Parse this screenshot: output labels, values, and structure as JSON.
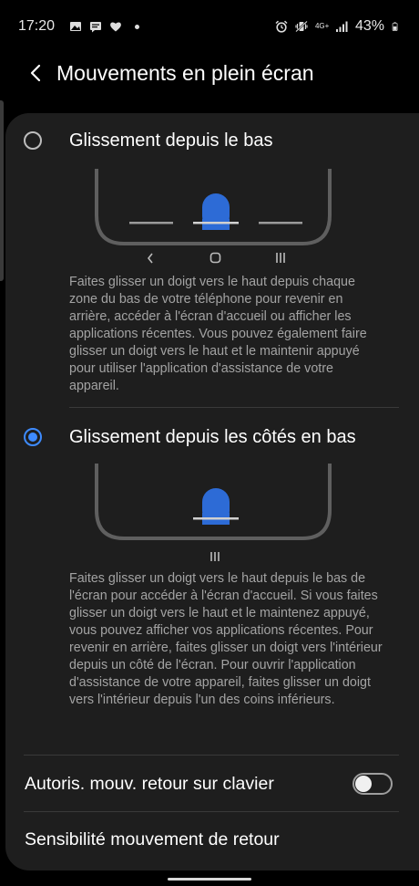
{
  "status_bar": {
    "time": "17:20",
    "battery_text": "43%",
    "network_label": "4G+",
    "left_icons": [
      "image-icon",
      "message-icon",
      "heart-icon",
      "dot-icon"
    ],
    "right_icons": [
      "alarm-icon",
      "vibrate-icon",
      "signal-icon",
      "battery-icon"
    ]
  },
  "app_bar": {
    "title": "Mouvements en plein écran",
    "back_icon": "chevron-left-icon"
  },
  "options": [
    {
      "label": "Glissement depuis le bas",
      "selected": false,
      "description": "Faites glisser un doigt vers le haut depuis chaque zone du bas de votre téléphone pour revenir en arrière, accéder à l'écran d'accueil ou afficher les applications récentes. Vous pouvez également faire glisser un doigt vers le haut et le maintenir appuyé pour utiliser l'application d'assistance de votre appareil.",
      "nav_icons": [
        "back-nav-icon",
        "home-nav-icon",
        "recents-nav-icon"
      ]
    },
    {
      "label": "Glissement depuis les côtés en bas",
      "selected": true,
      "description": "Faites glisser un doigt vers le haut depuis le bas de l'écran pour accéder à l'écran d'accueil. Si vous faites glisser un doigt vers le haut et le maintenez appuyé, vous pouvez afficher vos applications récentes. Pour revenir en arrière, faites glisser un doigt vers l'intérieur depuis un côté de l'écran. Pour ouvrir l'application d'assistance de votre appareil, faites glisser un doigt vers l'intérieur depuis l'un des coins inférieurs.",
      "nav_icons": [
        "recents-nav-icon"
      ]
    }
  ],
  "settings": [
    {
      "label": "Autoris. mouv. retour sur clavier",
      "toggle_on": false
    },
    {
      "label": "Sensibilité mouvement de retour"
    }
  ],
  "colors": {
    "accent": "#3e8bff",
    "card_bg": "#1e1e1e",
    "text_secondary": "#a3a3a3"
  }
}
